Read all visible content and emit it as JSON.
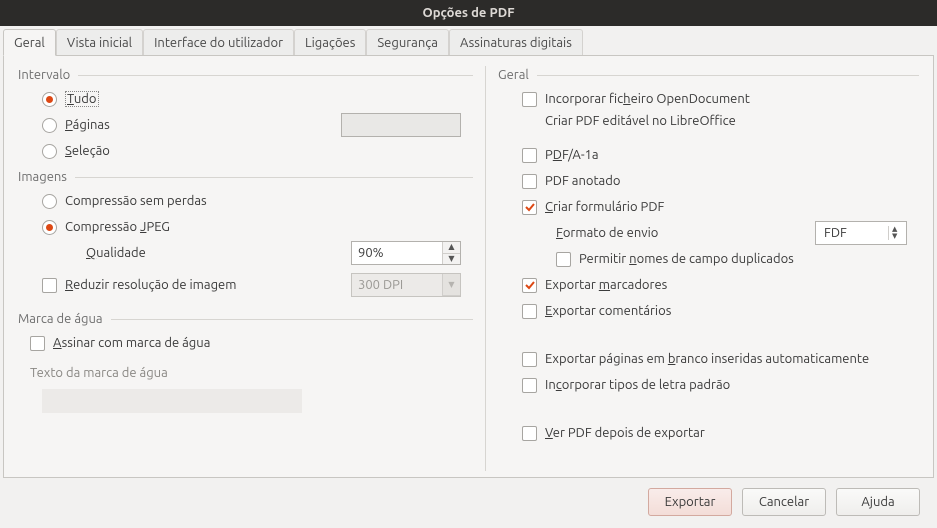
{
  "title": "Opções de PDF",
  "tabs": [
    "Geral",
    "Vista inicial",
    "Interface do utilizador",
    "Ligações",
    "Segurança",
    "Assinaturas digitais"
  ],
  "left": {
    "range_group": "Intervalo",
    "range_all": "Tudo",
    "range_pages": "Páginas",
    "range_pages_value": "",
    "range_selection": "Seleção",
    "images_group": "Imagens",
    "lossless": "Compressão sem perdas",
    "jpeg": "Compressão JPEG",
    "quality_label": "Qualidade",
    "quality_value": "90%",
    "reduce_res": "Reduzir resolução de imagem",
    "reduce_res_value": "300 DPI",
    "watermark_group": "Marca de água",
    "watermark_sign": "Assinar com marca de água",
    "watermark_text_label": "Texto da marca de água"
  },
  "right": {
    "general_group": "Geral",
    "embed_odf_l1": "Incorporar ficheiro OpenDocument",
    "embed_odf_l2": "Criar PDF editável no LibreOffice",
    "pdfa": "PDF/A-1a",
    "tagged": "PDF anotado",
    "create_form": "Criar formulário PDF",
    "submit_format_label": "Formato de envio",
    "submit_format_value": "FDF",
    "allow_dup": "Permitir nomes de campo duplicados",
    "export_bookmarks": "Exportar marcadores",
    "export_comments": "Exportar comentários",
    "export_blank": "Exportar páginas em branco inseridas automaticamente",
    "embed_fonts": "Incorporar tipos de letra padrão",
    "view_after": "Ver PDF depois de exportar"
  },
  "buttons": {
    "export": "Exportar",
    "cancel": "Cancelar",
    "help": "Ajuda"
  }
}
